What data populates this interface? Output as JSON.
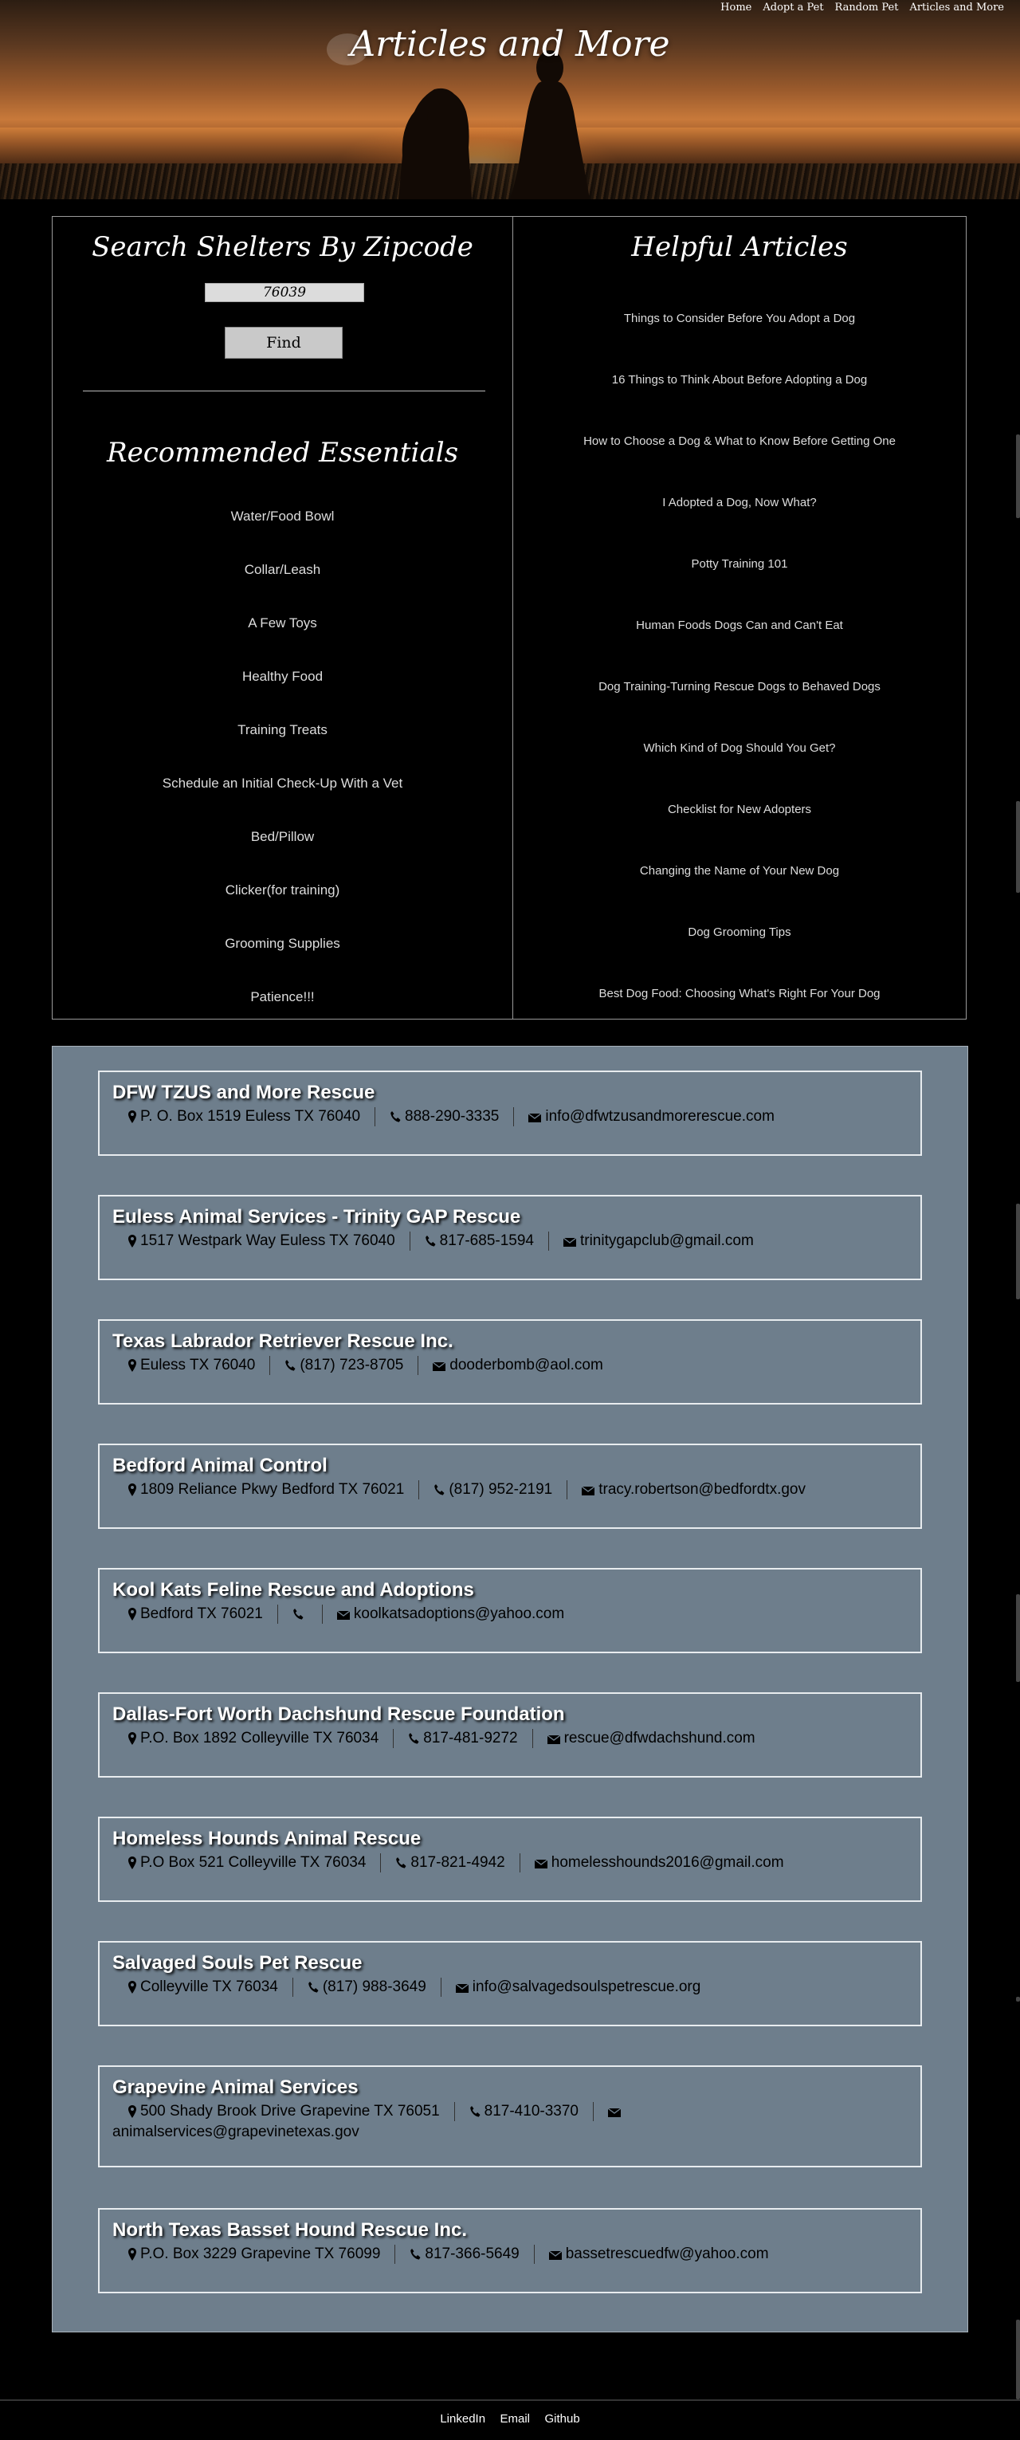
{
  "header": {
    "title": "Articles and More",
    "nav": [
      "Home",
      "Adopt a Pet",
      "Random Pet",
      "Articles and More"
    ]
  },
  "search": {
    "title": "Search Shelters By Zipcode",
    "zip_value": "76039",
    "button": "Find"
  },
  "essentials": {
    "title": "Recommended Essentials",
    "items": [
      "Water/Food Bowl",
      "Collar/Leash",
      "A Few Toys",
      "Healthy Food",
      "Training Treats",
      "Schedule an Initial Check-Up With a Vet",
      "Bed/Pillow",
      "Clicker(for training)",
      "Grooming Supplies",
      "Patience!!!"
    ]
  },
  "articles": {
    "title": "Helpful Articles",
    "items": [
      "Things to Consider Before You Adopt a Dog",
      "16 Things to Think About Before Adopting a Dog",
      "How to Choose a Dog & What to Know Before Getting One",
      "I Adopted a Dog, Now What?",
      "Potty Training 101",
      "Human Foods Dogs Can and Can't Eat",
      "Dog Training-Turning Rescue Dogs to Behaved Dogs",
      "Which Kind of Dog Should You Get?",
      "Checklist for New Adopters",
      "Changing the Name of Your New Dog",
      "Dog Grooming Tips",
      "Best Dog Food: Choosing What's Right For Your Dog"
    ]
  },
  "shelters": [
    {
      "name": "DFW TZUS and More Rescue",
      "address": "P. O. Box 1519 Euless TX 76040",
      "phone": "888-290-3335",
      "email": "info@dfwtzusandmorerescue.com"
    },
    {
      "name": "Euless Animal Services - Trinity GAP Rescue",
      "address": "1517 Westpark Way Euless TX 76040",
      "phone": "817-685-1594",
      "email": "trinitygapclub@gmail.com"
    },
    {
      "name": "Texas Labrador Retriever Rescue Inc.",
      "address": "Euless TX 76040",
      "phone": "(817) 723-8705",
      "email": "dooderbomb@aol.com"
    },
    {
      "name": "Bedford Animal Control",
      "address": "1809 Reliance Pkwy Bedford TX 76021",
      "phone": "(817) 952-2191",
      "email": "tracy.robertson@bedfordtx.gov"
    },
    {
      "name": "Kool Kats Feline Rescue and Adoptions",
      "address": "Bedford TX 76021",
      "phone": "",
      "email": "koolkatsadoptions@yahoo.com"
    },
    {
      "name": "Dallas-Fort Worth Dachshund Rescue Foundation",
      "address": "P.O. Box 1892 Colleyville TX 76034",
      "phone": "817-481-9272",
      "email": "rescue@dfwdachshund.com"
    },
    {
      "name": "Homeless Hounds Animal Rescue",
      "address": "P.O Box 521 Colleyville TX 76034",
      "phone": "817-821-4942",
      "email": "homelesshounds2016@gmail.com"
    },
    {
      "name": "Salvaged Souls Pet Rescue",
      "address": "Colleyville TX 76034",
      "phone": "(817) 988-3649",
      "email": "info@salvagedsoulspetrescue.org"
    },
    {
      "name": "Grapevine Animal Services",
      "address": "500 Shady Brook Drive Grapevine TX 76051",
      "phone": "817-410-3370",
      "email": "animalservices@grapevinetexas.gov"
    },
    {
      "name": "North Texas Basset Hound Rescue Inc.",
      "address": "P.O. Box 3229 Grapevine TX 76099",
      "phone": "817-366-5649",
      "email": "bassetrescuedfw@yahoo.com"
    }
  ],
  "footer": {
    "links": [
      "LinkedIn",
      "Email",
      "Github"
    ]
  }
}
